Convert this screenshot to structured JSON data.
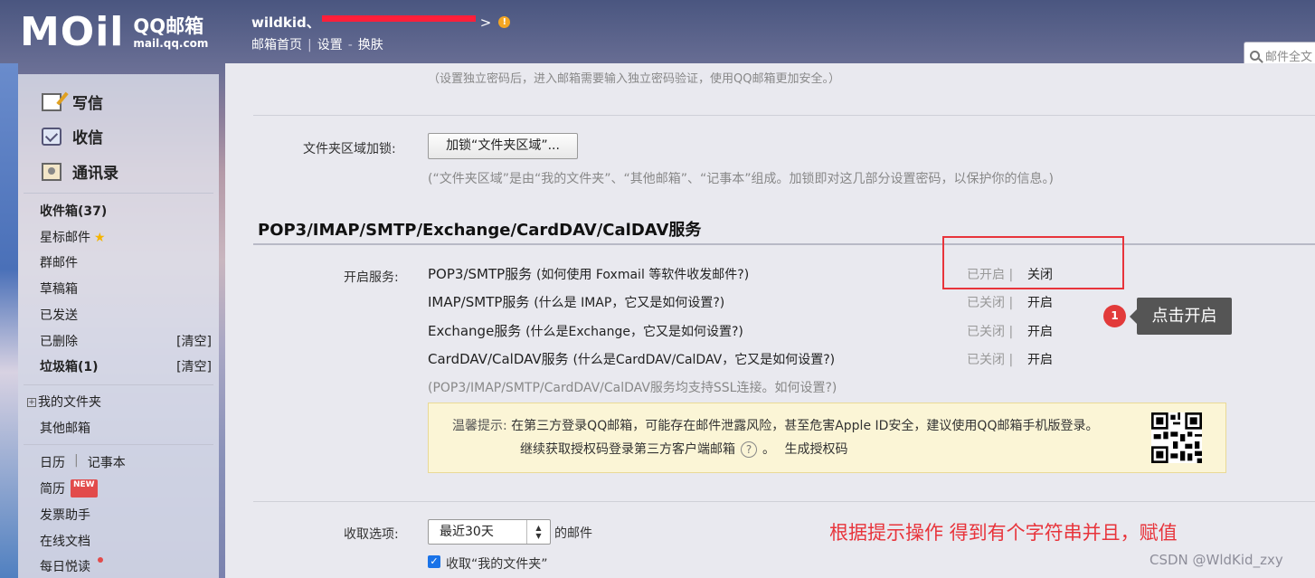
{
  "header": {
    "logo_text": "MOil",
    "brand_cn": "QQ邮箱",
    "brand_en": "mail.qq.com",
    "username": "wildkid、",
    "user_suffix": ">",
    "links": [
      "邮箱首页",
      "设置",
      "换肤"
    ],
    "search_placeholder": "邮件全文"
  },
  "sidebar": {
    "primary": [
      {
        "label": "写信",
        "icon": "compose-icon"
      },
      {
        "label": "收信",
        "icon": "inbox-icon"
      },
      {
        "label": "通讯录",
        "icon": "contacts-icon"
      }
    ],
    "folders": [
      {
        "label": "收件箱(37)",
        "bold": true
      },
      {
        "label": "星标邮件",
        "icon": "star-icon"
      },
      {
        "label": "群邮件"
      },
      {
        "label": "草稿箱"
      },
      {
        "label": "已发送"
      },
      {
        "label": "已删除",
        "action": "[清空]"
      },
      {
        "label": "垃圾箱(1)",
        "bold": true,
        "action": "[清空]"
      }
    ],
    "my_folders": "我的文件夹",
    "other_mail": "其他邮箱",
    "tools": {
      "calendar": "日历",
      "sep": "|",
      "notes": "记事本",
      "resume": "简历",
      "new_badge": "NEW",
      "invoice": "发票助手",
      "docs": "在线文档",
      "daily": "每日悦读"
    }
  },
  "main": {
    "top_hint": "（设置独立密码后，进入邮箱需要输入独立密码验证，使用QQ邮箱更加安全。）",
    "folder_lock": {
      "label": "文件夹区域加锁:",
      "button": "加锁“文件夹区域”...",
      "hint": "(“文件夹区域”是由“我的文件夹”、“其他邮箱”、“记事本”组成。加锁即对这几部分设置密码，以保护你的信息。)"
    },
    "section_title": "POP3/IMAP/SMTP/Exchange/CardDAV/CalDAV服务",
    "services_label": "开启服务:",
    "services": [
      {
        "name": "POP3/SMTP服务",
        "hint": "(如何使用 Foxmail 等软件收发邮件?)",
        "status": "已开启",
        "sep": "|",
        "action": "关闭"
      },
      {
        "name": "IMAP/SMTP服务",
        "hint": "(什么是 IMAP，它又是如何设置?)",
        "status": "已关闭",
        "sep": "|",
        "action": "开启"
      },
      {
        "name": "Exchange服务",
        "hint": "(什么是Exchange，它又是如何设置?)",
        "status": "已关闭",
        "sep": "|",
        "action": "开启"
      },
      {
        "name": "CardDAV/CalDAV服务",
        "hint": "(什么是CardDAV/CalDAV，它又是如何设置?)",
        "status": "已关闭",
        "sep": "|",
        "action": "开启"
      }
    ],
    "ssl_note": "(POP3/IMAP/SMTP/CardDAV/CalDAV服务均支持SSL连接。如何设置?)",
    "notice": {
      "label": "温馨提示:",
      "line1": "在第三方登录QQ邮箱，可能存在邮件泄露风险，甚至危害Apple ID安全，建议使用QQ邮箱手机版登录。",
      "line2": "继续获取授权码登录第三方客户端邮箱",
      "line2_end": "。",
      "auth_link": "生成授权码"
    },
    "fetch": {
      "label": "收取选项:",
      "select_value": "最近30天",
      "suffix": "的邮件",
      "checkbox_label": "收取“我的文件夹”"
    }
  },
  "annotations": {
    "step_number": "1",
    "tip_text": "点击开启",
    "red_note": "根据提示操作 得到有个字符串并且，赋值",
    "watermark": "CSDN @WldKid_zxy"
  },
  "colors": {
    "annotation_red": "#e8343b",
    "notice_bg": "#fbf5d6",
    "tip_bg": "#555555"
  }
}
